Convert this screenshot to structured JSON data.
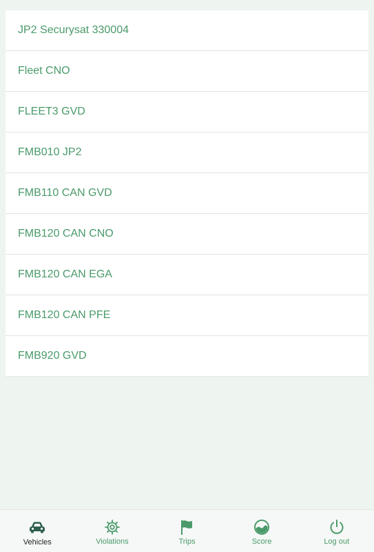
{
  "vehicles": [
    {
      "label": "JP2 Securysat 330004"
    },
    {
      "label": "Fleet CNO"
    },
    {
      "label": "FLEET3 GVD"
    },
    {
      "label": "FMB010 JP2"
    },
    {
      "label": "FMB110 CAN GVD"
    },
    {
      "label": "FMB120 CAN CNO"
    },
    {
      "label": "FMB120 CAN EGA"
    },
    {
      "label": "FMB120 CAN PFE"
    },
    {
      "label": "FMB920 GVD"
    }
  ],
  "nav": {
    "active": "Vehicles",
    "items": [
      {
        "label": "Vehicles",
        "icon": "car-icon"
      },
      {
        "label": "Violations",
        "icon": "gear-icon"
      },
      {
        "label": "Trips",
        "icon": "flag-icon"
      },
      {
        "label": "Score",
        "icon": "gauge-icon"
      },
      {
        "label": "Log out",
        "icon": "power-icon"
      }
    ]
  },
  "colors": {
    "accent": "#4a9a6a",
    "active_icon": "#2f5f4f",
    "background": "#eef4ef",
    "list_background": "#ffffff"
  }
}
